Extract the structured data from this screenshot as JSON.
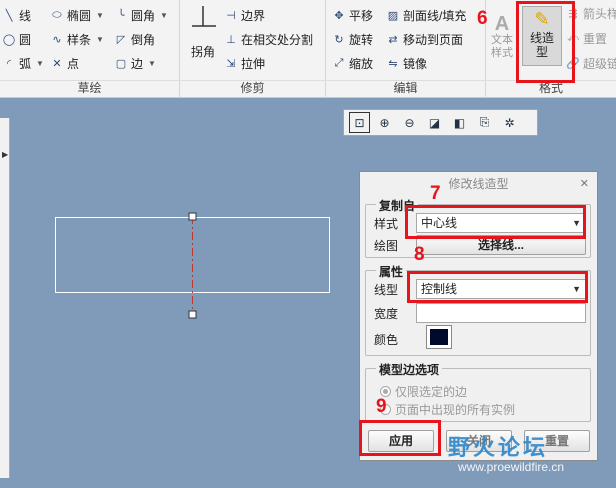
{
  "ribbon": {
    "sketch": {
      "label": "草绘",
      "items": [
        "线",
        "椭圆",
        "圆角",
        "圆",
        "样条",
        "倒角",
        "弧",
        "点",
        "边"
      ]
    },
    "trim": {
      "label": "修剪",
      "corner": "拐角",
      "boundary": "边界",
      "split": "在相交处分割",
      "stretch": "拉伸"
    },
    "edit": {
      "label": "编辑",
      "items": [
        "平移",
        "剖面线/填充",
        "旋转",
        "移动到页面",
        "缩放",
        "镜像"
      ]
    },
    "format": {
      "label": "格式",
      "text_style": "文本样式",
      "line_style": "线造型",
      "arrow": "箭头样",
      "reset": "重置",
      "hyperlink": "超级链"
    }
  },
  "view_toolbar": {
    "icons": [
      "zoom-fit-icon",
      "zoom-in-icon",
      "zoom-out-icon",
      "repaint-icon",
      "display-style-icon",
      "annotation-icon",
      "snap-icon"
    ]
  },
  "dialog": {
    "title": "修改线造型",
    "copy_section": {
      "legend": "复制自",
      "style_label": "样式",
      "style_value": "中心线",
      "drawing_label": "绘图",
      "select_line_button": "选择线..."
    },
    "properties_section": {
      "legend": "属性",
      "linetype_label": "线型",
      "linetype_value": "控制线",
      "width_label": "宽度",
      "width_value": "",
      "color_label": "颜色",
      "color_value": "#000a2a"
    },
    "model_edges": {
      "legend": "模型边选项",
      "option_selected_only": "仅限选定的边",
      "option_all_instances": "页面中出现的所有实例"
    },
    "apply_button": "应用",
    "close_button": "关闭",
    "reset_button": "重置"
  },
  "annotations": [
    "6",
    "7",
    "8",
    "9"
  ],
  "watermark": {
    "brand": "野火论坛",
    "url": "www.proewildfire.cn"
  },
  "colors": {
    "canvas_bg": "#7f9bb9",
    "highlight": "#e8141c",
    "centerline": "#c0392b"
  }
}
